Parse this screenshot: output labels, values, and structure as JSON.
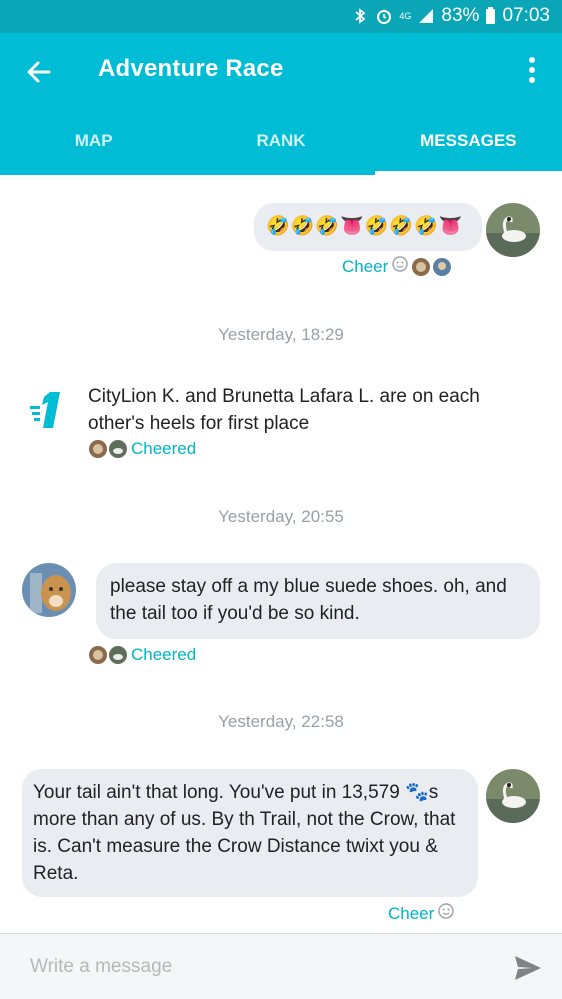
{
  "status_bar": {
    "battery": "83%",
    "time": "07:03",
    "network_label": "4G"
  },
  "app_bar": {
    "title": "Adventure Race"
  },
  "tabs": [
    {
      "label": "MAP",
      "active": false
    },
    {
      "label": "RANK",
      "active": false
    },
    {
      "label": "MESSAGES",
      "active": true
    }
  ],
  "messages": {
    "first": {
      "emojis": "🤣🤣🤣👅🤣🤣🤣👅",
      "cheer_label": "Cheer"
    },
    "ts1": "Yesterday, 18:29",
    "rank_event": {
      "text": "CityLion K. and Brunetta Lafara L. are on each other's heels for first place",
      "cheered_label": "Cheered"
    },
    "ts2": "Yesterday, 20:55",
    "second": {
      "text": "please stay off a my blue suede shoes. oh, and the tail too if you'd be so kind.",
      "cheered_label": "Cheered"
    },
    "ts3": "Yesterday, 22:58",
    "third": {
      "text": "Your tail ain't that long.  You've put in 13,579 🐾s more than any of us.  By th Trail, not the Crow, that is.  Can't measure the Crow Distance twixt you & Reta.",
      "cheer_label": "Cheer"
    }
  },
  "composer": {
    "placeholder": "Write a message"
  },
  "colors": {
    "primary": "#00bcd4",
    "status": "#0aa6b8",
    "accent": "#00b5c8"
  }
}
